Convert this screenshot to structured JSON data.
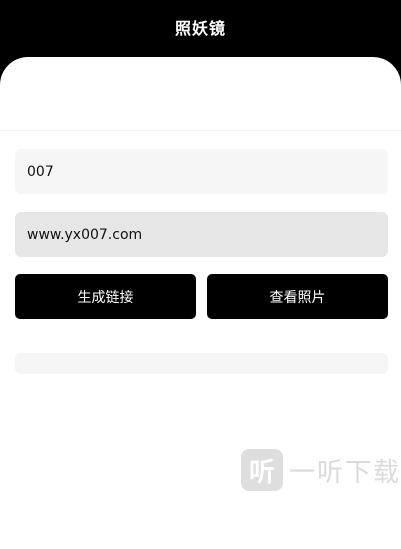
{
  "header": {
    "title": "照妖镜"
  },
  "form": {
    "code_value": "007",
    "url_value": "www.yx007.com"
  },
  "actions": {
    "generate_label": "生成链接",
    "view_label": "查看照片"
  },
  "watermark": {
    "logo_glyph": "听",
    "text": "一听下载"
  },
  "colors": {
    "header_bg": "#000000",
    "button_bg": "#000000",
    "button_text": "#ffffff"
  }
}
